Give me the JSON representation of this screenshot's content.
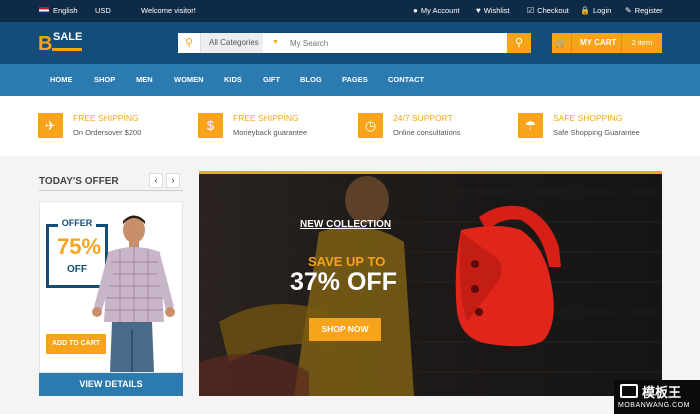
{
  "topbar": {
    "language": "English",
    "currency": "USD",
    "welcome": "Welcome visitor!",
    "links": [
      {
        "label": "My Account",
        "icon": "user-icon"
      },
      {
        "label": "Wishlist",
        "icon": "heart-icon"
      },
      {
        "label": "Checkout",
        "icon": "checkout-icon"
      },
      {
        "label": "Login",
        "icon": "lock-icon"
      },
      {
        "label": "Register",
        "icon": "edit-icon"
      }
    ]
  },
  "header": {
    "logo_letter": "B",
    "logo_text": "SALE",
    "search": {
      "category": "All Categories",
      "placeholder": "My Search"
    },
    "cart": {
      "label": "MY CART",
      "count": "2 item"
    }
  },
  "nav": [
    "HOME",
    "SHOP",
    "MEN",
    "WOMEN",
    "KIDS",
    "GIFT",
    "BLOG",
    "PAGES",
    "CONTACT"
  ],
  "features": [
    {
      "title": "FREE SHIPPING",
      "desc": "On Ordersover $200",
      "icon": "plane-icon"
    },
    {
      "title": "FREE SHIPPING",
      "desc": "Moneyback guarantee",
      "icon": "dollar-icon"
    },
    {
      "title": "24/7 SUPPORT",
      "desc": "Online consultations",
      "icon": "clock-icon"
    },
    {
      "title": "SAFE SHOPPING",
      "desc": "Safe Shopping Guarantee",
      "icon": "umbrella-icon"
    }
  ],
  "offer": {
    "heading": "TODAY'S OFFER",
    "badge_top": "OFFER",
    "percent": "75%",
    "badge_bottom": "OFF",
    "add_to_cart": "ADD TO CART",
    "view_details": "VIEW DETAILS"
  },
  "hero": {
    "tag": "NEW COLLECTION",
    "line1": "SAVE UP TO",
    "line2": "37% OFF",
    "cta": "SHOP NOW"
  },
  "watermark": {
    "title": "模板王",
    "url": "MOBANWANG.COM"
  },
  "colors": {
    "accent": "#f7a31b",
    "topbar": "#0e2a47",
    "header": "#134d7a",
    "nav": "#2b7bb0"
  }
}
